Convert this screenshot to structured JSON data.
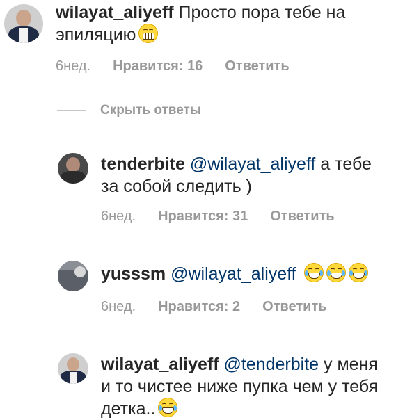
{
  "comments": [
    {
      "username": "wilayat_aliyeff",
      "text_line1": " Просто пора тебе на",
      "text_line2": "эпиляцию",
      "emoji": "grimacing-face-icon",
      "time": "6нед.",
      "likes": "Нравится: 16",
      "reply": "Ответить"
    },
    {
      "username": "tenderbite",
      "mention": "@wilayat_aliyeff",
      "text_line1": " а тебе",
      "text_line2": "за собой следить )",
      "time": "6нед.",
      "likes": "Нравится: 31",
      "reply": "Ответить"
    },
    {
      "username": "yusssm",
      "mention": "@wilayat_aliyeff",
      "emoji": "tears-of-joy-icon",
      "time": "6нед.",
      "likes": "Нравится: 2",
      "reply": "Ответить"
    },
    {
      "username": "wilayat_aliyeff",
      "mention": "@tenderbite",
      "text_line1": " у меня",
      "text_line2": "и то чистее ниже пупка чем у тебя",
      "text_line3": "детка..",
      "emoji": "tears-of-joy-icon"
    }
  ],
  "hide_replies": "Скрыть ответы",
  "colors": {
    "mention": "#003569",
    "meta": "#999999",
    "text": "#262626"
  }
}
